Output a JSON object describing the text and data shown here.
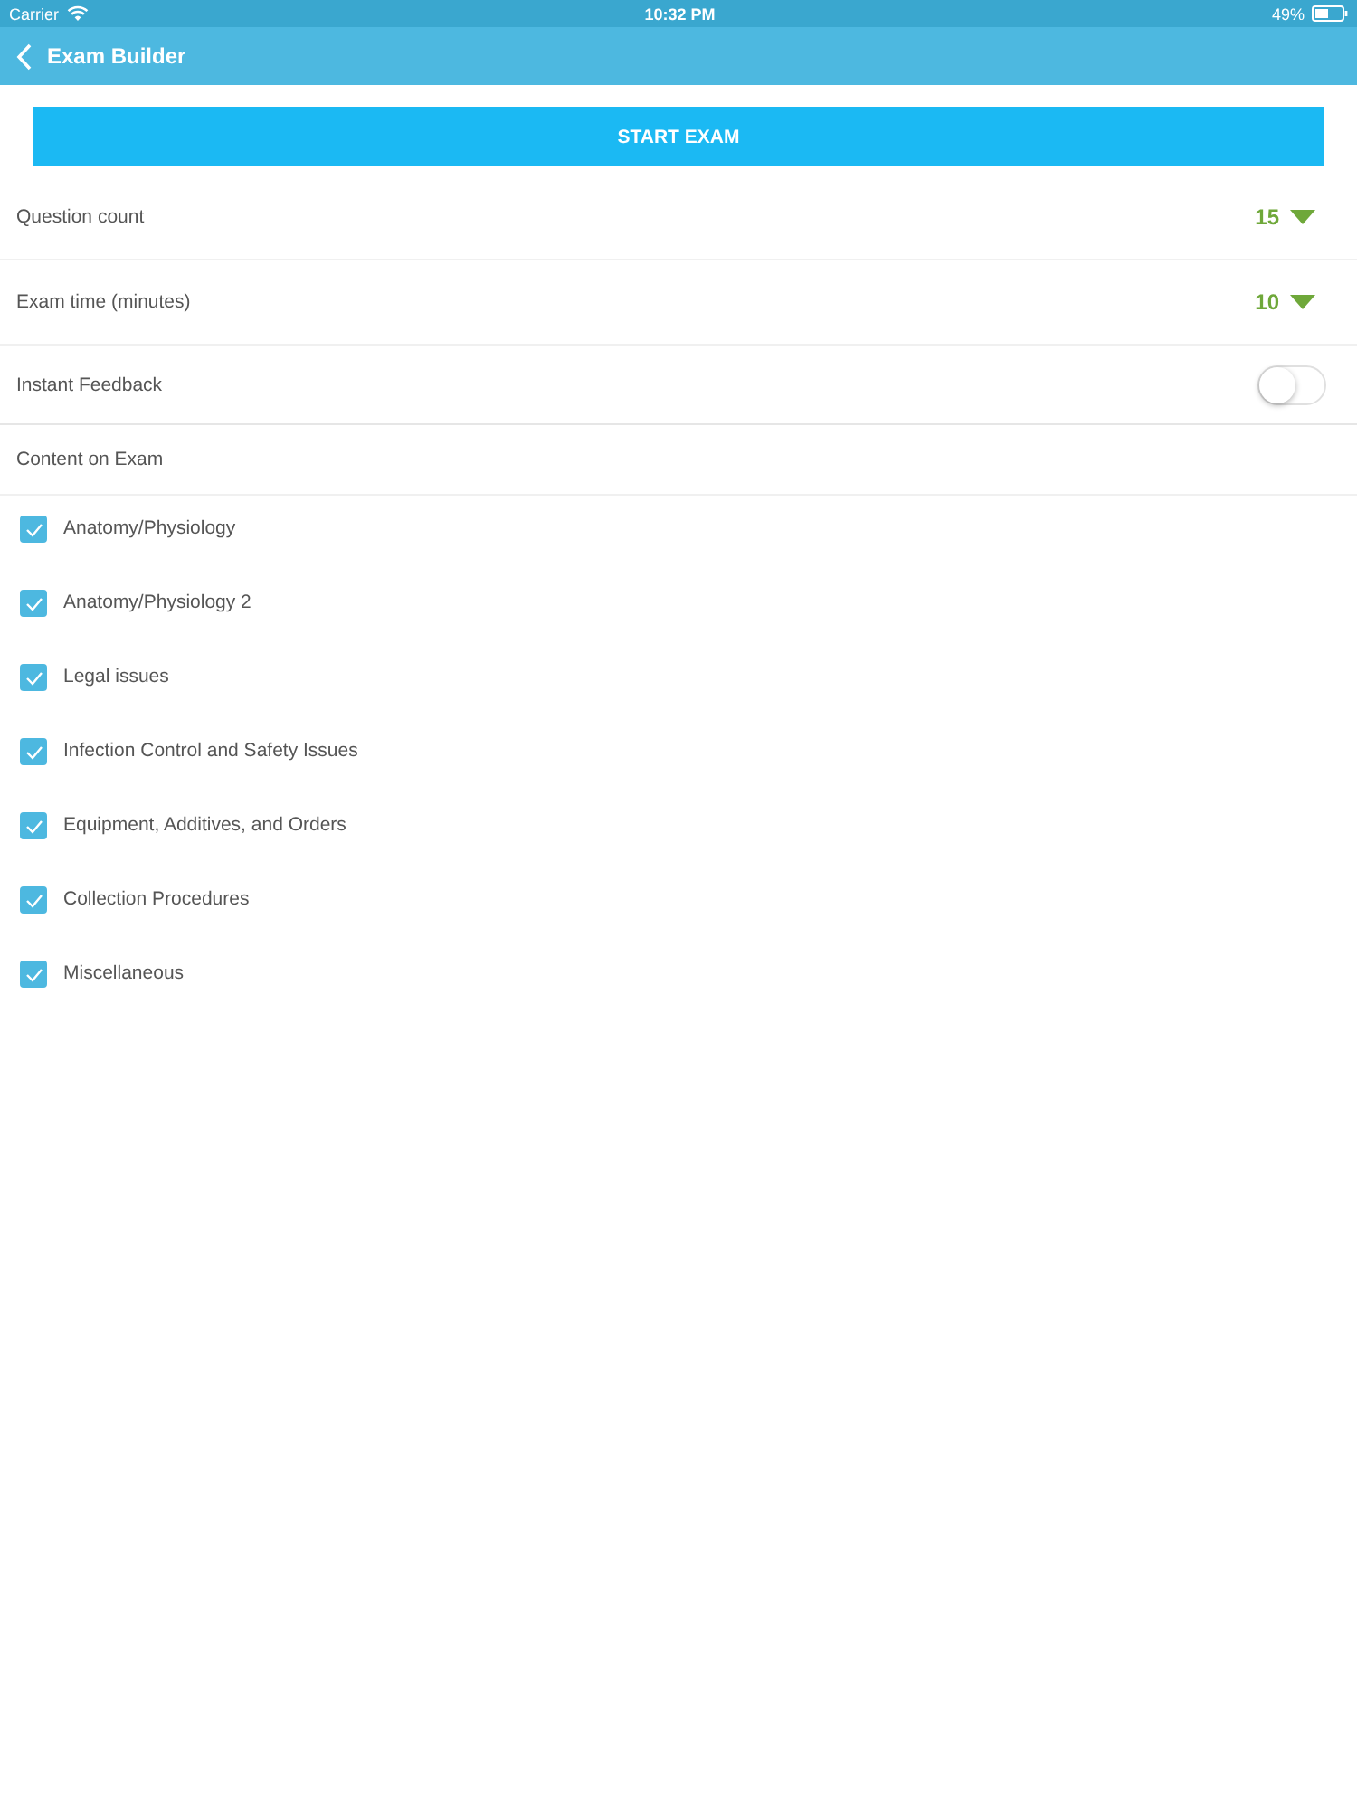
{
  "status_bar": {
    "carrier": "Carrier",
    "time": "10:32 PM",
    "battery": "49%"
  },
  "nav_bar": {
    "title": "Exam Builder"
  },
  "start_button": "START EXAM",
  "settings": [
    {
      "kind": "dropdown",
      "label": "Question count",
      "value": "15"
    },
    {
      "kind": "dropdown",
      "label": "Exam time (minutes)",
      "value": "10"
    },
    {
      "kind": "toggle",
      "label": "Instant Feedback",
      "on": false
    }
  ],
  "content_section": {
    "title": "Content on Exam",
    "items": [
      {
        "label": "Anatomy/Physiology",
        "checked": true
      },
      {
        "label": "Anatomy/Physiology 2",
        "checked": true
      },
      {
        "label": "Legal issues",
        "checked": true
      },
      {
        "label": "Infection Control and Safety Issues",
        "checked": true
      },
      {
        "label": "Equipment, Additives, and Orders",
        "checked": true
      },
      {
        "label": "Collection Procedures",
        "checked": true
      },
      {
        "label": "Miscellaneous",
        "checked": true
      }
    ]
  }
}
